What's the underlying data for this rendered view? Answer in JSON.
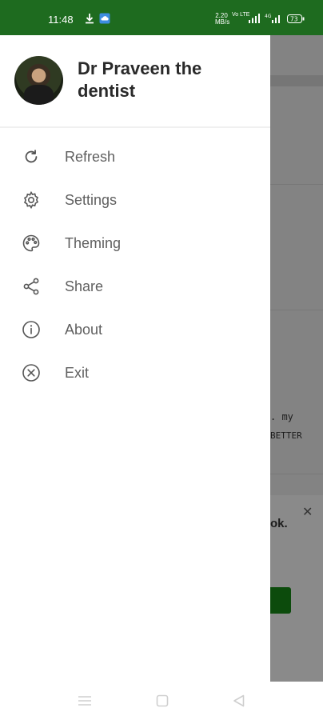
{
  "status_bar": {
    "time": "11:48",
    "network_speed": "2.20 MB/s",
    "volte_label": "Vo LTE",
    "battery": "73"
  },
  "drawer": {
    "user_name": "Dr Praveen the dentist",
    "menu": [
      {
        "label": "Refresh",
        "icon": "refresh-icon"
      },
      {
        "label": "Settings",
        "icon": "gear-icon"
      },
      {
        "label": "Theming",
        "icon": "palette-icon"
      },
      {
        "label": "Share",
        "icon": "share-icon"
      },
      {
        "label": "About",
        "icon": "info-icon"
      },
      {
        "label": "Exit",
        "icon": "close-circle-icon"
      }
    ]
  },
  "background_app": {
    "text_line_1": ". my",
    "text_line_2": "BETTER",
    "text_line_3": "ok."
  },
  "colors": {
    "status_bar": "#1e6b1f",
    "menu_text": "#5f5f5f",
    "name_text": "#2a2a2a"
  }
}
